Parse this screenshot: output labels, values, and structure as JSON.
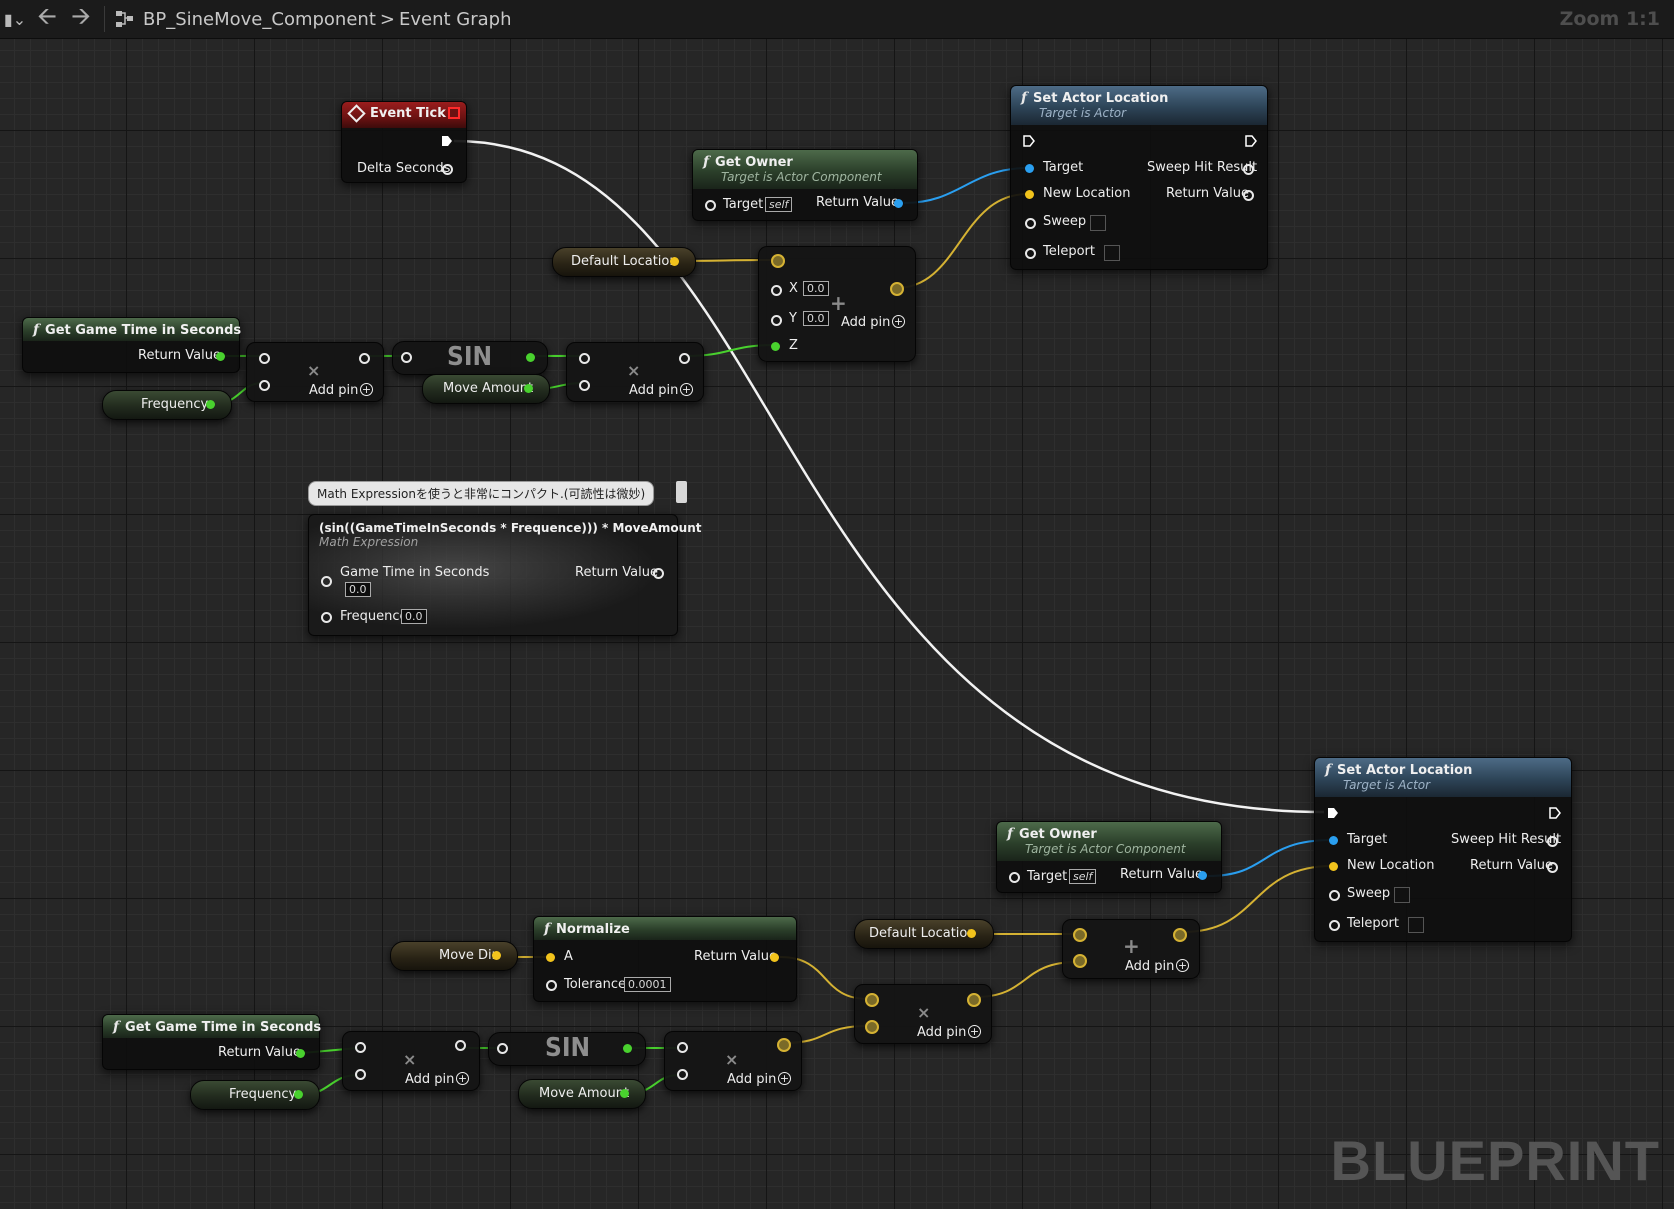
{
  "toolbar": {
    "breadcrumb_blueprint": "BP_SineMove_Component",
    "breadcrumb_separator": ">",
    "breadcrumb_graph": "Event Graph",
    "zoom": "Zoom 1:1"
  },
  "event_tick": {
    "title": "Event Tick",
    "delta_seconds": "Delta Seconds"
  },
  "get_owner_top": {
    "title": "Get Owner",
    "subtitle": "Target is Actor Component",
    "target": "Target",
    "self": "self",
    "return_value": "Return Value"
  },
  "set_actor_top": {
    "title": "Set Actor Location",
    "subtitle": "Target is Actor",
    "target": "Target",
    "new_location": "New Location",
    "sweep": "Sweep",
    "teleport": "Teleport",
    "sweep_hit_result": "Sweep Hit Result",
    "return_value": "Return Value"
  },
  "default_location_top": "Default Location",
  "make_vector_top": {
    "x": "X",
    "y": "Y",
    "z": "Z",
    "x_value": "0.0",
    "y_value": "0.0",
    "add_pin": "Add pin"
  },
  "game_time_top": {
    "title": "Get Game Time in Seconds",
    "return_value": "Return Value"
  },
  "frequency_top": "Frequency",
  "multiply_top_1": {
    "add_pin": "Add pin"
  },
  "sin_top": "SIN",
  "move_amount_top": "Move Amount",
  "multiply_top_2": {
    "add_pin": "Add pin"
  },
  "math_expr": {
    "comment": "Math Expressionを使うと非常にコンパクト.(可読性は微妙)",
    "title": "(sin((GameTimeInSeconds * Frequence))) * MoveAmount",
    "subtitle": "Math Expression",
    "game_time": "Game Time in Seconds",
    "game_time_value": "0.0",
    "frequence": "Frequence",
    "frequence_value": "0.0",
    "return_value": "Return Value"
  },
  "set_actor_bottom": {
    "title": "Set Actor Location",
    "subtitle": "Target is Actor",
    "target": "Target",
    "new_location": "New Location",
    "sweep": "Sweep",
    "teleport": "Teleport",
    "sweep_hit_result": "Sweep Hit Result",
    "return_value": "Return Value"
  },
  "get_owner_bottom": {
    "title": "Get Owner",
    "subtitle": "Target is Actor Component",
    "target": "Target",
    "self": "self",
    "return_value": "Return Value"
  },
  "default_location_bottom": "Default Location",
  "add_vector_bottom": {
    "add_pin": "Add pin"
  },
  "normalize": {
    "title": "Normalize",
    "a": "A",
    "tolerance": "Tolerance",
    "tolerance_value": "0.0001",
    "return_value": "Return Value"
  },
  "move_dir": "Move Dir",
  "multiply_vec_bottom": {
    "add_pin": "Add pin"
  },
  "game_time_bottom": {
    "title": "Get Game Time in Seconds",
    "return_value": "Return Value"
  },
  "frequency_bottom": "Frequency",
  "multiply_bottom_1": {
    "add_pin": "Add pin"
  },
  "sin_bottom": "SIN",
  "move_amount_bottom": "Move Amount",
  "multiply_bottom_2": {
    "add_pin": "Add pin"
  },
  "watermark": "BLUEPRINT",
  "colors": {
    "exec": "#ffffff",
    "float": "#49d12e",
    "vector": "#f2c31c",
    "object": "#2a9ff0",
    "struct": "#b51515"
  }
}
